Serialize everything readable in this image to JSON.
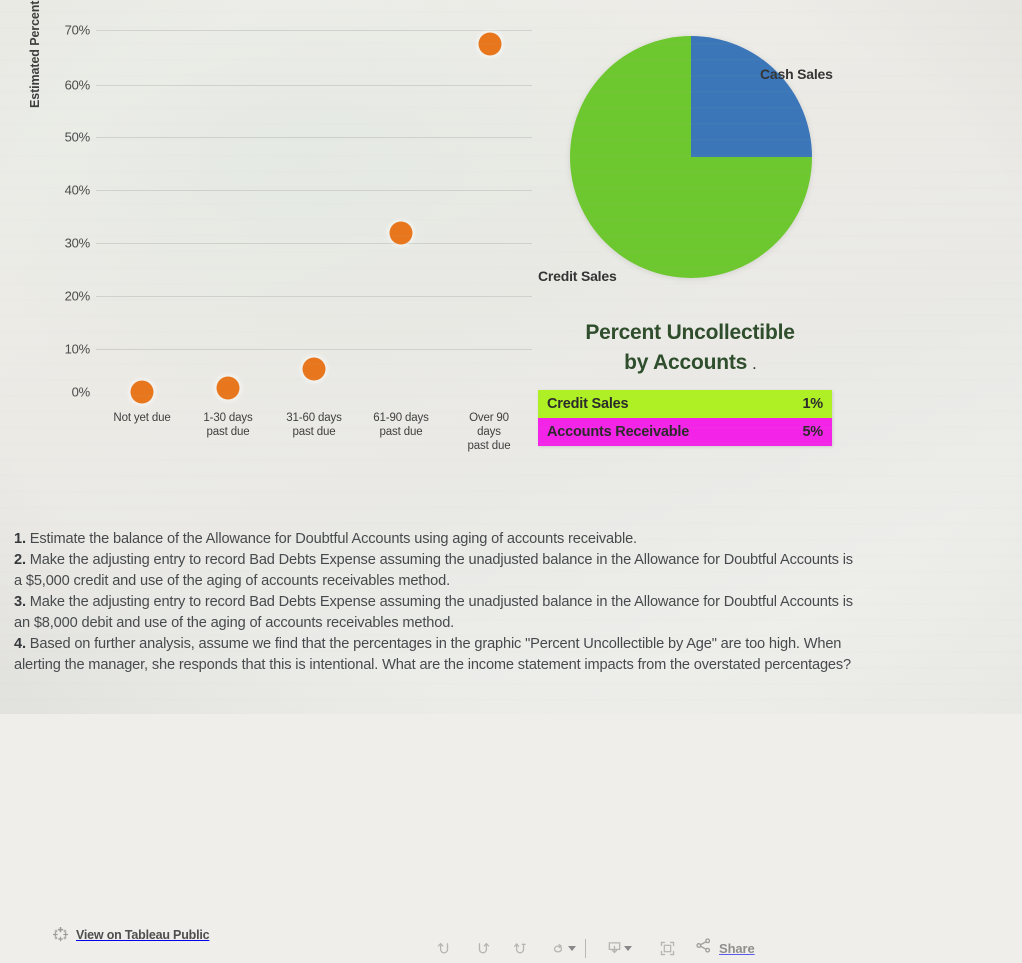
{
  "chart_data": [
    {
      "type": "scatter",
      "title": "",
      "xlabel": "",
      "ylabel": "Estimated Percent Uncollectible",
      "ylim": [
        0,
        70
      ],
      "yticks": [
        "0%",
        "10%",
        "20%",
        "30%",
        "40%",
        "50%",
        "60%",
        "70%"
      ],
      "grid": true,
      "legend": "none",
      "categories": [
        "Not yet due",
        "1-30 days past due",
        "31-60 days past due",
        "61-90 days past due",
        "Over 90 days past due"
      ],
      "category_lines": [
        [
          "Not yet due",
          ""
        ],
        [
          "1-30 days",
          "past due"
        ],
        [
          "31-60 days",
          "past due"
        ],
        [
          "61-90 days",
          "past due"
        ],
        [
          "Over 90 days",
          "past due"
        ]
      ],
      "values": [
        0,
        1,
        5,
        32,
        67
      ],
      "marker_color": "#e8761c"
    },
    {
      "type": "pie",
      "title": "",
      "labels": [
        "Cash Sales",
        "Credit Sales"
      ],
      "values": [
        25,
        75
      ],
      "colors": [
        "#3b76b8",
        "#6dc72e"
      ],
      "legend": "labels placed around slices"
    },
    {
      "type": "table",
      "title": "Percent Uncollectible by Accounts",
      "title_line1": "Percent Uncollectible",
      "title_line2": "by Accounts",
      "title_trailing_mark": ".",
      "rows": [
        {
          "name": "Credit Sales",
          "value": "1%",
          "color": "#aef024"
        },
        {
          "name": "Accounts Receivable",
          "value": "5%",
          "color": "#f423e8"
        }
      ]
    }
  ],
  "toolbar": {
    "tableau_link_label": "View on Tableau Public",
    "tableau_logo_icon": "tableau-logo-icon",
    "undo_icon": "undo-icon",
    "redo_icon": "redo-icon",
    "revert_icon": "revert-icon",
    "refresh_icon": "refresh-icon",
    "refresh_caret_icon": "chevron-down-icon",
    "download_icon": "download-icon",
    "download_caret_icon": "chevron-down-icon",
    "fullscreen_icon": "fullscreen-icon",
    "share_icon": "share-icon",
    "share_label": "Share"
  },
  "questions": [
    {
      "num": "1.",
      "lines": [
        "Estimate the balance of the Allowance for Doubtful Accounts using aging of accounts receivable."
      ]
    },
    {
      "num": "2.",
      "lines": [
        "Make the adjusting entry to record Bad Debts Expense assuming the unadjusted balance in the Allowance for Doubtful Accounts is",
        "a $5,000 credit and use of the aging of accounts receivables method."
      ]
    },
    {
      "num": "3.",
      "lines": [
        "Make the adjusting entry to record Bad Debts Expense assuming the unadjusted balance in the Allowance for Doubtful Accounts is",
        "an $8,000 debit and use of the aging of accounts receivables method."
      ]
    },
    {
      "num": "4.",
      "lines": [
        "Based on further analysis, assume we find that the percentages in the graphic \"Percent Uncollectible by Age\" are too high. When",
        "alerting the manager, she responds that this is intentional. What are the income statement impacts from the overstated percentages?"
      ]
    }
  ]
}
